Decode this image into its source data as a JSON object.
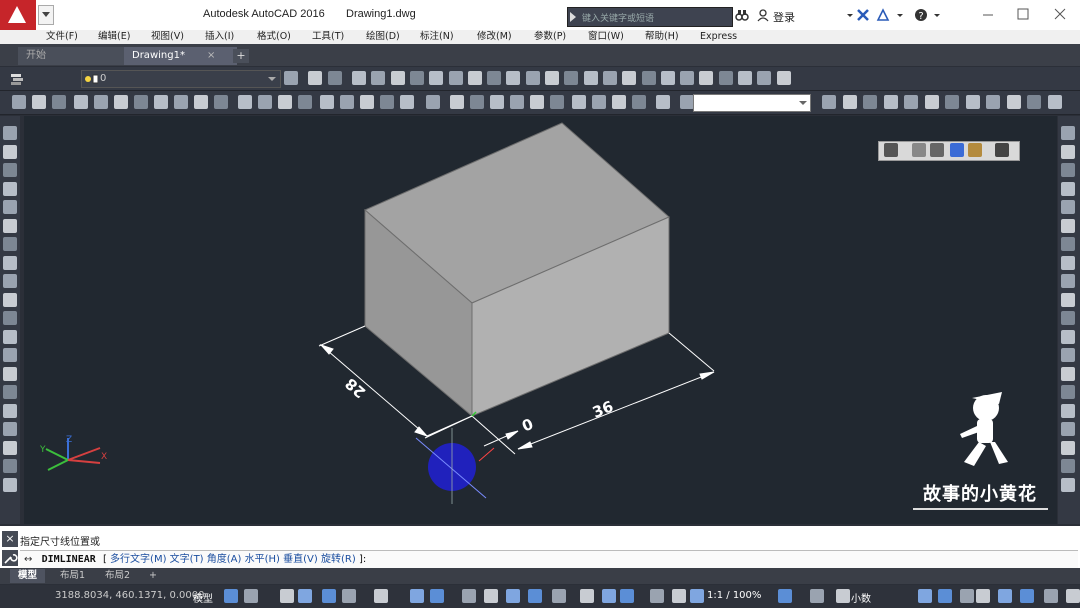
{
  "app": {
    "title": "Autodesk AutoCAD 2016",
    "document": "Drawing1.dwg",
    "search_placeholder": "键入关键字或短语",
    "login_label": "登录"
  },
  "menu": [
    "文件(F)",
    "编辑(E)",
    "视图(V)",
    "插入(I)",
    "格式(O)",
    "工具(T)",
    "绘图(D)",
    "标注(N)",
    "修改(M)",
    "参数(P)",
    "窗口(W)",
    "帮助(H)",
    "Express"
  ],
  "tabs": {
    "start": "开始",
    "drawing": "Drawing1*",
    "close": "×",
    "add": "+"
  },
  "layer": {
    "current": "0"
  },
  "drawing": {
    "dim_left": "28",
    "dim_mid": "0",
    "dim_right": "36",
    "ucs_x": "X",
    "ucs_y": "Y",
    "ucs_z": "Z"
  },
  "command": {
    "prompt": "指定尺寸线位置或",
    "command_name": "DIMLINEAR",
    "options": [
      "多行文字(M)",
      "文字(T)",
      "角度(A)",
      "水平(H)",
      "垂直(V)",
      "旋转(R)"
    ],
    "bracket_open": "[",
    "bracket_close": "]:",
    "icon": "↔"
  },
  "layout_tabs": [
    "模型",
    "布局1",
    "布局2"
  ],
  "layout_add": "+",
  "status": {
    "coords": "3188.8034, 460.1371, 0.0000",
    "model": "模型",
    "scale": "1:1 / 100%",
    "units": "小数"
  },
  "watermark": {
    "text": "故事的小黄花"
  },
  "colors": {
    "accent": "#c6252a",
    "viewport": "#212830",
    "box_top": "#a3a3a3",
    "box_left": "#979797",
    "box_right": "#b0b0b0",
    "dim_color": "#ffffff",
    "cursor_circle": "#2020cc"
  }
}
